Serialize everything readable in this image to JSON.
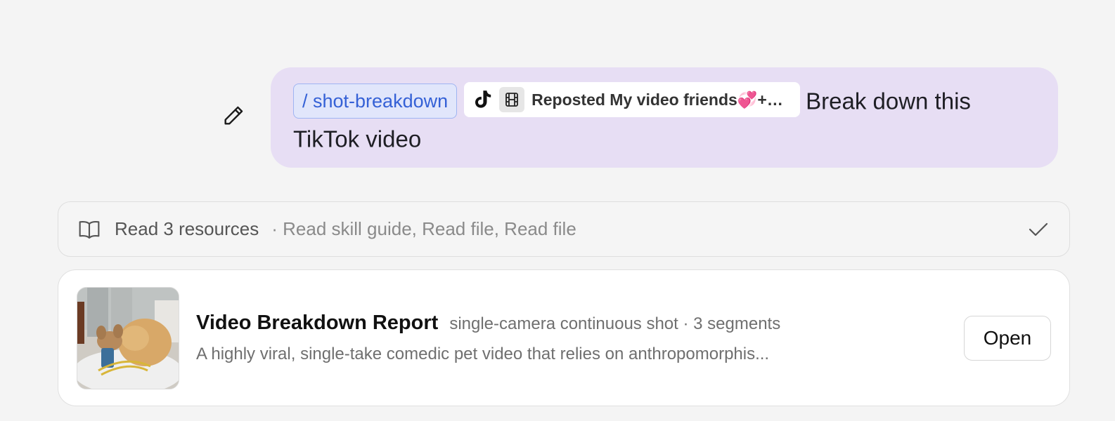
{
  "message": {
    "command_chip": "/ shot-breakdown",
    "attachment": {
      "platform_icon": "tiktok-icon",
      "type_icon": "film-icon",
      "name": "Reposted My video friends💞+vie..."
    },
    "text": "Break down this TikTok video",
    "bubble_color": "#e7def4",
    "edit_icon": "pencil-icon"
  },
  "resources": {
    "icon": "book-open-icon",
    "title": "Read 3 resources",
    "detail": "· Read skill guide, Read file, Read file",
    "status_icon": "check-icon"
  },
  "report": {
    "thumbnail": "video-thumbnail",
    "title": "Video Breakdown Report",
    "meta": "single-camera continuous shot · 3 segments",
    "summary": "A highly viral, single-take comedic pet video that relies on anthropomorphis...",
    "open_label": "Open"
  }
}
